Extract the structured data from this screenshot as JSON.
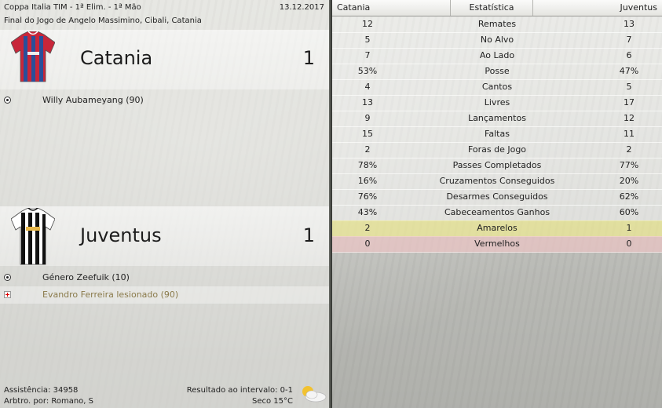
{
  "match": {
    "competition": "Coppa Italia TIM - 1ª Elim. - 1ª Mão",
    "date": "13.12.2017",
    "venue": "Final do Jogo de Angelo Massimino, Cibali, Catania"
  },
  "home": {
    "name": "Catania",
    "score": "1",
    "kit_colors": [
      "#c8263a",
      "#2a4f9a"
    ],
    "events": [
      {
        "type": "goal",
        "icon": "ball-icon",
        "text": "Willy Aubameyang (90)"
      }
    ]
  },
  "away": {
    "name": "Juventus",
    "score": "1",
    "kit_colors": [
      "#111111",
      "#ffffff"
    ],
    "events": [
      {
        "type": "goal",
        "icon": "ball-icon",
        "text": "Género Zeefuik (10)"
      },
      {
        "type": "injury",
        "icon": "injury-icon",
        "text": "Evandro Ferreira lesionado (90)",
        "color": "#8a7a4a"
      }
    ]
  },
  "footer": {
    "attendance": "Assistência: 34958",
    "referee": "Arbtro. por: Romano, S",
    "halftime": "Resultado ao intervalo: 0-1",
    "weather": "Seco 15°C",
    "weather_icon": "partly-cloudy-icon"
  },
  "stats": {
    "header_home": "Catania",
    "header_label": "Estatística",
    "header_away": "Juventus",
    "rows": [
      {
        "home": "12",
        "label": "Remates",
        "away": "13"
      },
      {
        "home": "5",
        "label": "No Alvo",
        "away": "7"
      },
      {
        "home": "7",
        "label": "Ao Lado",
        "away": "6"
      },
      {
        "home": "53%",
        "label": "Posse",
        "away": "47%"
      },
      {
        "home": "4",
        "label": "Cantos",
        "away": "5"
      },
      {
        "home": "13",
        "label": "Livres",
        "away": "17"
      },
      {
        "home": "9",
        "label": "Lançamentos",
        "away": "12"
      },
      {
        "home": "15",
        "label": "Faltas",
        "away": "11"
      },
      {
        "home": "2",
        "label": "Foras de Jogo",
        "away": "2"
      },
      {
        "home": "78%",
        "label": "Passes Completados",
        "away": "77%"
      },
      {
        "home": "16%",
        "label": "Cruzamentos Conseguidos",
        "away": "20%"
      },
      {
        "home": "76%",
        "label": "Desarmes Conseguidos",
        "away": "62%"
      },
      {
        "home": "43%",
        "label": "Cabeceamentos Ganhos",
        "away": "60%"
      },
      {
        "home": "2",
        "label": "Amarelos",
        "away": "1",
        "highlight": "yellow"
      },
      {
        "home": "0",
        "label": "Vermelhos",
        "away": "0",
        "highlight": "red"
      }
    ]
  }
}
